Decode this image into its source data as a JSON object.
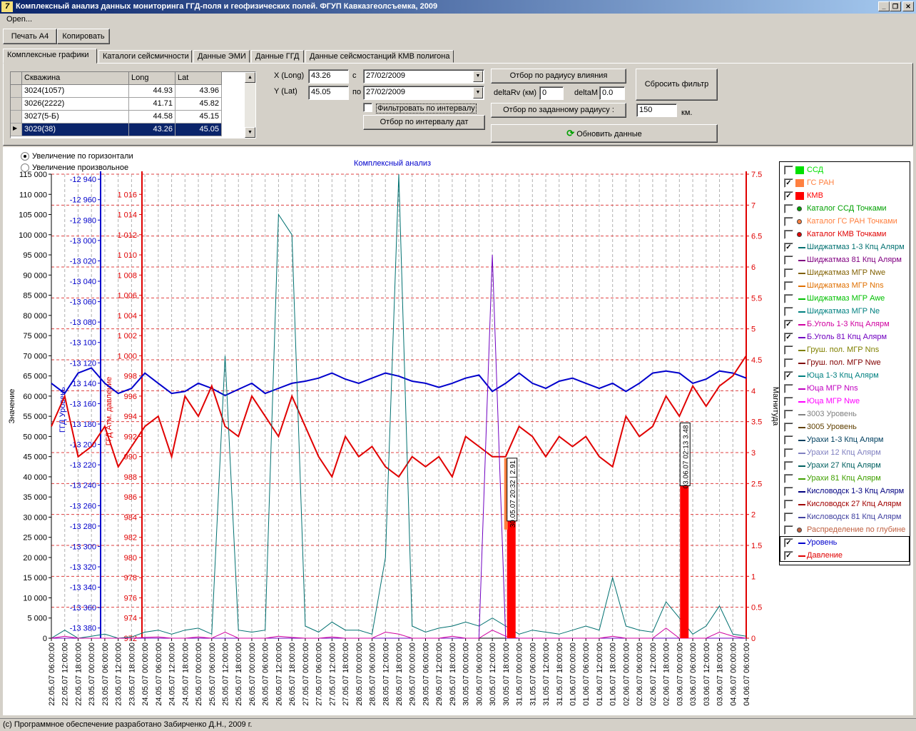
{
  "window": {
    "title": "Комплексный анализ данных мониторинга ГГД-поля и геофизических полей. ФГУП Кавказгеолсъемка, 2009",
    "app_icon": "7"
  },
  "menu": {
    "open": "Open..."
  },
  "toolbar": {
    "print_a4": "Печать А4",
    "copy": "Копировать"
  },
  "tabs": [
    {
      "label": "Комплексные графики",
      "active": true
    },
    {
      "label": "Каталоги сейсмичности"
    },
    {
      "label": "Данные ЭМИ"
    },
    {
      "label": "Данные ГГД"
    },
    {
      "label": "Данные сейсмостанций КМВ полигона"
    }
  ],
  "wells": {
    "headers": [
      "Скважина",
      "Long",
      "Lat"
    ],
    "rows": [
      {
        "name": "3024(1057)",
        "long": "44.93",
        "lat": "43.96"
      },
      {
        "name": "3026(2222)",
        "long": "41.71",
        "lat": "45.82"
      },
      {
        "name": "3027(5-Б)",
        "long": "44.58",
        "lat": "45.15"
      },
      {
        "name": "3029(38)",
        "long": "43.26",
        "lat": "45.05",
        "selected": true
      }
    ]
  },
  "filter": {
    "x_label": "X (Long)",
    "x_value": "43.26",
    "y_label": "Y (Lat)",
    "y_value": "45.05",
    "from_label": "с",
    "from_date": "27/02/2009",
    "to_label": "по",
    "to_date": "27/02/2009",
    "interval_checkbox": "Фильтровать по интервалу",
    "interval_button": "Отбор по интервалу дат",
    "radius_influence_button": "Отбор по радиусу влияния",
    "delta_rv_label": "deltaRv (км)",
    "delta_rv": "0",
    "delta_m_label": "deltaM",
    "delta_m": "0.0",
    "given_radius_button": "Отбор по заданному радиусу :",
    "radius_value": "150",
    "radius_unit": "км.",
    "reset_button": "Сбросить фильтр",
    "refresh_button": "Обновить данные"
  },
  "zoom": {
    "horizontal": "Увеличение по горизонтали",
    "arbitrary": "Увеличение произвольное",
    "selected": "horizontal"
  },
  "chart": {
    "title": "Комплексный анализ",
    "y_left_title": "Значение",
    "y_right_title": "Магнитуда",
    "y_level_title": "ГГД Уровень",
    "y_pressure_title": "ГГД Атм. давление",
    "colors": {
      "level": "#0000cc",
      "pressure": "#e00000",
      "teal": "#007070",
      "purple": "#7000c0",
      "magenta": "#d000a0",
      "kmv": "#ff0000",
      "gsran": "#ff8040"
    }
  },
  "chart_data": {
    "type": "line",
    "title": "Комплексный анализ",
    "ylabel": "Значение",
    "y2label": "Магнитуда",
    "ylim": [
      0,
      115000
    ],
    "y2lim": [
      0,
      7.5
    ],
    "yticks": [
      "0",
      "5 000",
      "10 000",
      "15 000",
      "20 000",
      "25 000",
      "30 000",
      "35 000",
      "40 000",
      "45 000",
      "50 000",
      "55 000",
      "60 000",
      "65 000",
      "70 000",
      "75 000",
      "80 000",
      "85 000",
      "90 000",
      "95 000",
      "100 000",
      "105 000",
      "110 000",
      "115 000"
    ],
    "level_ticks": [
      "-12 940",
      "-12 960",
      "-12 980",
      "-13 000",
      "-13 020",
      "-13 040",
      "-13 060",
      "-13 080",
      "-13 100",
      "-13 120",
      "-13 140",
      "-13 160",
      "-13 180",
      "-13 200",
      "-13 220",
      "-13 240",
      "-13 260",
      "-13 280",
      "-13 300",
      "-13 320",
      "-13 340",
      "-13 360",
      "-13 380"
    ],
    "pressure_ticks": [
      "972",
      "974",
      "976",
      "978",
      "980",
      "982",
      "984",
      "986",
      "988",
      "990",
      "992",
      "994",
      "996",
      "998",
      "1 000",
      "1 002",
      "1 004",
      "1 006",
      "1 008",
      "1 010",
      "1 012",
      "1 014",
      "1 016"
    ],
    "mag_ticks": [
      "0",
      "0.5",
      "1",
      "1.5",
      "2",
      "2.5",
      "3",
      "3.5",
      "4",
      "4.5",
      "5",
      "5.5",
      "6",
      "6.5",
      "7",
      "7.5"
    ],
    "x": [
      "22.05.07 06:00:00",
      "22.05.07 12:00:00",
      "22.05.07 18:00:00",
      "23.05.07 00:00:00",
      "23.05.07 06:00:00",
      "23.05.07 12:00:00",
      "23.05.07 18:00:00",
      "24.05.07 00:00:00",
      "24.05.07 06:00:00",
      "24.05.07 12:00:00",
      "24.05.07 18:00:00",
      "25.05.07 00:00:00",
      "25.05.07 06:00:00",
      "25.05.07 12:00:00",
      "25.05.07 18:00:00",
      "26.05.07 00:00:00",
      "26.05.07 06:00:00",
      "26.05.07 12:00:00",
      "26.05.07 18:00:00",
      "27.05.07 00:00:00",
      "27.05.07 06:00:00",
      "27.05.07 12:00:00",
      "27.05.07 18:00:00",
      "28.05.07 00:00:00",
      "28.05.07 06:00:00",
      "28.05.07 12:00:00",
      "28.05.07 18:00:00",
      "29.05.07 00:00:00",
      "29.05.07 06:00:00",
      "29.05.07 12:00:00",
      "29.05.07 18:00:00",
      "30.05.07 00:00:00",
      "30.05.07 06:00:00",
      "30.05.07 12:00:00",
      "30.05.07 18:00:00",
      "31.05.07 00:00:00",
      "31.05.07 06:00:00",
      "31.05.07 12:00:00",
      "31.05.07 18:00:00",
      "01.06.07 00:00:00",
      "01.06.07 06:00:00",
      "01.06.07 12:00:00",
      "01.06.07 18:00:00",
      "02.06.07 00:00:00",
      "02.06.07 06:00:00",
      "02.06.07 12:00:00",
      "02.06.07 18:00:00",
      "03.06.07 00:00:00",
      "03.06.07 06:00:00",
      "03.06.07 12:00:00",
      "03.06.07 18:00:00",
      "04.06.07 00:00:00",
      "04.06.07 06:00:00"
    ],
    "series": [
      {
        "name": "Уровень",
        "axis": "level",
        "values": [
          -13140,
          -13150,
          -13130,
          -13125,
          -13140,
          -13150,
          -13145,
          -13130,
          -13140,
          -13150,
          -13148,
          -13140,
          -13145,
          -13152,
          -13146,
          -13140,
          -13150,
          -13145,
          -13140,
          -13138,
          -13135,
          -13130,
          -13136,
          -13140,
          -13135,
          -13130,
          -13133,
          -13138,
          -13140,
          -13144,
          -13140,
          -13135,
          -13132,
          -13148,
          -13140,
          -13130,
          -13140,
          -13145,
          -13138,
          -13135,
          -13140,
          -13145,
          -13140,
          -13148,
          -13140,
          -13130,
          -13128,
          -13130,
          -13140,
          -13136,
          -13128,
          -13130,
          -13135
        ]
      },
      {
        "name": "Давление",
        "axis": "pressure",
        "values": [
          993,
          996,
          990,
          991,
          993,
          989,
          991,
          993,
          994,
          990,
          996,
          994,
          997,
          993,
          992,
          996,
          994,
          992,
          996,
          993,
          990,
          988,
          992,
          990,
          991,
          989,
          988,
          990,
          989,
          990,
          988,
          992,
          991,
          990,
          990,
          993,
          992,
          990,
          992,
          991,
          992,
          990,
          989,
          994,
          992,
          993,
          996,
          994,
          997,
          995,
          997,
          998,
          1000
        ]
      },
      {
        "name": "Шиджатмаз 1-3 Кпц Алярм",
        "axis": "value",
        "values": [
          0,
          2000,
          0,
          500,
          1000,
          0,
          300,
          1500,
          2000,
          1000,
          2000,
          2500,
          1000,
          70000,
          2000,
          1500,
          2000,
          105000,
          100000,
          3000,
          1500,
          4000,
          2000,
          2000,
          1000,
          20000,
          115000,
          3000,
          1500,
          2500,
          3000,
          4000,
          3000,
          5000,
          3000,
          1000,
          2000,
          1500,
          1000,
          2000,
          3000,
          2000,
          15000,
          3000,
          2000,
          1500,
          9000,
          5000,
          1000,
          3000,
          8000,
          1000,
          500
        ]
      },
      {
        "name": "Б.Уголь 81 Кпц Алярм",
        "axis": "value",
        "values": [
          0,
          0,
          0,
          0,
          0,
          0,
          0,
          0,
          0,
          0,
          0,
          0,
          0,
          0,
          0,
          0,
          0,
          0,
          0,
          0,
          0,
          0,
          0,
          0,
          0,
          0,
          0,
          0,
          0,
          0,
          0,
          0,
          0,
          95000,
          0,
          0,
          0,
          0,
          0,
          0,
          0,
          0,
          0,
          0,
          0,
          0,
          0,
          0,
          0,
          0,
          0,
          0,
          0
        ]
      },
      {
        "name": "Б.Уголь 1-3 Кпц Алярм",
        "axis": "value",
        "values": [
          0,
          500,
          0,
          0,
          0,
          0,
          0,
          200,
          300,
          0,
          0,
          300,
          0,
          1500,
          0,
          0,
          0,
          500,
          200,
          0,
          0,
          300,
          0,
          0,
          0,
          1500,
          1000,
          0,
          0,
          0,
          500,
          0,
          0,
          2000,
          500,
          0,
          0,
          0,
          0,
          0,
          0,
          0,
          500,
          0,
          0,
          0,
          2500,
          0,
          0,
          0,
          1500,
          500,
          0
        ]
      }
    ],
    "events": [
      {
        "name": "КМВ",
        "date": "30.05.07 20:32",
        "magnitude": 2.91,
        "label": "30.05.07 20:32 | 2.91"
      },
      {
        "name": "КМВ",
        "date": "03.06.07 02:13",
        "magnitude": 3.48,
        "label": "03.06.07 02:13 3.48"
      }
    ],
    "grid": true
  },
  "legend": [
    {
      "label": "ССД",
      "checked": false,
      "kind": "swatch",
      "color": "#00e000"
    },
    {
      "label": "ГС РАН",
      "checked": true,
      "kind": "swatch",
      "color": "#ff8040"
    },
    {
      "label": "КМВ",
      "checked": true,
      "kind": "swatch",
      "color": "#ff0000"
    },
    {
      "label": "Каталог ССД Точками",
      "checked": false,
      "kind": "dot",
      "color": "#00a000"
    },
    {
      "label": "Каталог ГС РАН Точками",
      "checked": false,
      "kind": "dot",
      "color": "#ff8040"
    },
    {
      "label": "Каталог КМВ Точками",
      "checked": false,
      "kind": "dot",
      "color": "#e00000"
    },
    {
      "label": "Шиджатмаз 1-3 Кпц Алярм",
      "checked": true,
      "kind": "line",
      "color": "#007070"
    },
    {
      "label": "Шиджатмаз 81 Кпц Алярм",
      "checked": false,
      "kind": "line",
      "color": "#800080"
    },
    {
      "label": "Шиджатмаз МГР Nwe",
      "checked": false,
      "kind": "line",
      "color": "#806000"
    },
    {
      "label": "Шиджатмаз МГР Nns",
      "checked": false,
      "kind": "line",
      "color": "#e07000"
    },
    {
      "label": "Шиджатмаз МГР Awe",
      "checked": false,
      "kind": "line",
      "color": "#00c000"
    },
    {
      "label": "Шиджатмаз МГР Ne",
      "checked": false,
      "kind": "line",
      "color": "#008080"
    },
    {
      "label": "Б.Уголь 1-3 Кпц Алярм",
      "checked": true,
      "kind": "line",
      "color": "#d000a0"
    },
    {
      "label": "Б.Уголь 81 Кпц Алярм",
      "checked": true,
      "kind": "line",
      "color": "#7000c0"
    },
    {
      "label": "Груш. пол. МГР Nns",
      "checked": false,
      "kind": "line",
      "color": "#808000"
    },
    {
      "label": "Груш. пол. МГР Nwe",
      "checked": false,
      "kind": "line",
      "color": "#800000"
    },
    {
      "label": "Юца 1-3 Кпц Алярм",
      "checked": true,
      "kind": "line",
      "color": "#008080"
    },
    {
      "label": "Юца МГР Nns",
      "checked": false,
      "kind": "line",
      "color": "#c000c0"
    },
    {
      "label": "Юца МГР Nwe",
      "checked": false,
      "kind": "line",
      "color": "#ff00ff"
    },
    {
      "label": "3003 Уровень",
      "checked": false,
      "kind": "line",
      "color": "#808080"
    },
    {
      "label": "3005 Уровень",
      "checked": false,
      "kind": "line",
      "color": "#604000"
    },
    {
      "label": "Урахи 1-3 Кпц Алярм",
      "checked": false,
      "kind": "line",
      "color": "#004060"
    },
    {
      "label": "Урахи 12 Кпц Алярм",
      "checked": false,
      "kind": "line",
      "color": "#8080c0"
    },
    {
      "label": "Урахи 27 Кпц Алярм",
      "checked": false,
      "kind": "line",
      "color": "#006060"
    },
    {
      "label": "Урахи 81 Кпц Алярм",
      "checked": false,
      "kind": "line",
      "color": "#40a000"
    },
    {
      "label": "Кисловодск 1-3 Кпц Алярм",
      "checked": false,
      "kind": "line",
      "color": "#000080"
    },
    {
      "label": "Кисловодск 27 Кпц Алярм",
      "checked": false,
      "kind": "line",
      "color": "#a00000"
    },
    {
      "label": "Кисловодск 81 Кпц Алярм",
      "checked": false,
      "kind": "line",
      "color": "#4040a0"
    },
    {
      "label": "Распределение по глубине",
      "checked": false,
      "kind": "dot",
      "color": "#c06040"
    },
    {
      "label": "Уровень",
      "checked": true,
      "kind": "line",
      "color": "#0000cc"
    },
    {
      "label": "Давление",
      "checked": true,
      "kind": "line",
      "color": "#e00000"
    }
  ],
  "status": "(с) Программное обеспечение разработано Забирченко Д.Н., 2009 г."
}
